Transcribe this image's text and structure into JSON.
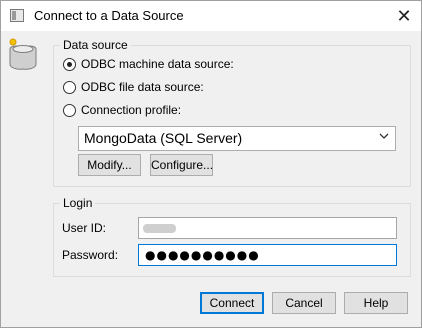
{
  "window": {
    "title": "Connect to a Data Source"
  },
  "icons": {
    "app": "window-icon",
    "close": "close-icon",
    "datasource": "database-icon",
    "dropdown": "chevron-down-icon"
  },
  "datasource": {
    "legend": "Data source",
    "options": [
      {
        "label": "ODBC machine data source:",
        "checked": true
      },
      {
        "label": "ODBC file data source:",
        "checked": false
      },
      {
        "label": "Connection profile:",
        "checked": false
      }
    ],
    "selected": "MongoData (SQL Server)",
    "modify_label": "Modify...",
    "configure_label": "Configure..."
  },
  "login": {
    "legend": "Login",
    "userid_label": "User ID:",
    "password_label": "Password:",
    "password_mask": "●●●●●●●●●●"
  },
  "buttons": {
    "connect": "Connect",
    "cancel": "Cancel",
    "help": "Help"
  }
}
